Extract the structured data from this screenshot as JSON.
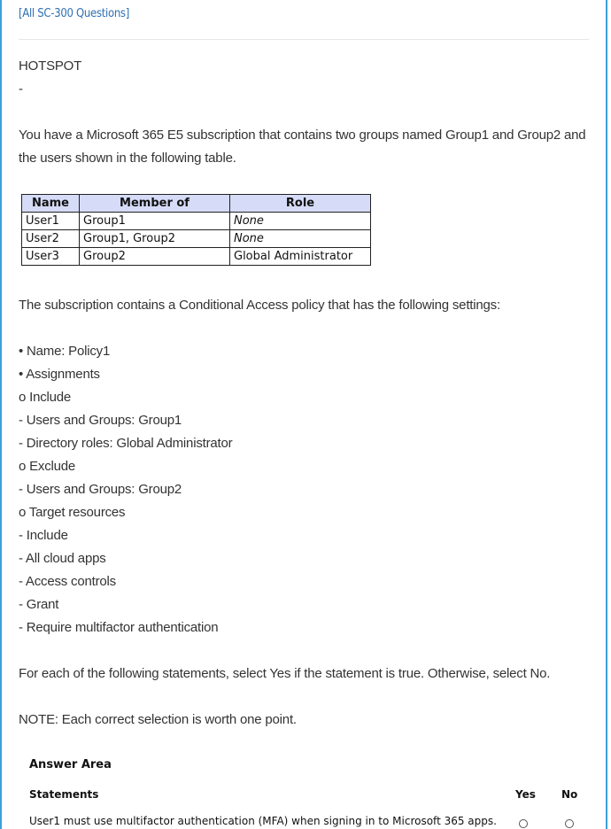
{
  "nav": {
    "link": "[All SC-300 Questions]"
  },
  "question": {
    "type": "HOTSPOT",
    "dash": "-",
    "intro": "You have a Microsoft 365 E5 subscription that contains two groups named Group1 and Group2 and the users shown in the following table.",
    "table": {
      "headers": [
        "Name",
        "Member of",
        "Role"
      ],
      "rows": [
        [
          "User1",
          "Group1",
          "None"
        ],
        [
          "User2",
          "Group1, Group2",
          "None"
        ],
        [
          "User3",
          "Group2",
          "Global Administrator"
        ]
      ]
    },
    "policy_intro": "The subscription contains a Conditional Access policy that has the following settings:",
    "policy_lines": [
      "• Name: Policy1",
      "• Assignments",
      "o Include",
      "- Users and Groups: Group1",
      "- Directory roles: Global Administrator",
      "o Exclude",
      "- Users and Groups: Group2",
      "o Target resources",
      "- Include",
      "- All cloud apps",
      "- Access controls",
      "- Grant",
      "- Require multifactor authentication"
    ],
    "instruction": "For each of the following statements, select Yes if the statement is true. Otherwise, select No.",
    "note": "NOTE: Each correct selection is worth one point."
  },
  "answer_area": {
    "title": "Answer Area",
    "statements_header": "Statements",
    "yes_header": "Yes",
    "no_header": "No",
    "statements": [
      "User1 must use multifactor authentication (MFA) when signing in to Microsoft 365 apps."
    ]
  }
}
